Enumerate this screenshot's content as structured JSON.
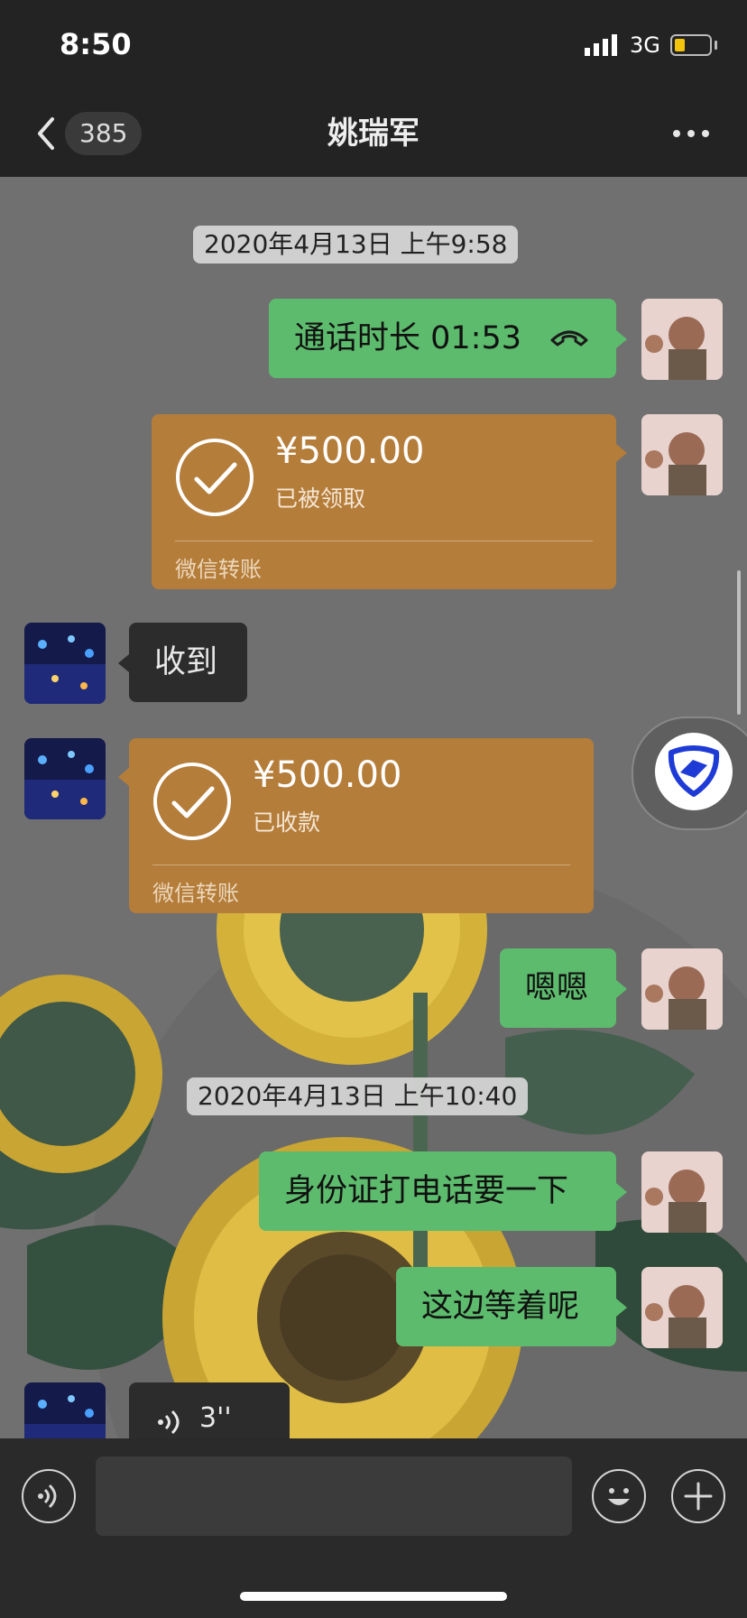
{
  "status_bar": {
    "time": "8:50",
    "network": "3G"
  },
  "header": {
    "unread_count": "385",
    "title": "姚瑞军"
  },
  "messages": {
    "ts1": "2020年4月13日 上午9:58",
    "call": "通话时长 01:53",
    "transfer1": {
      "amount": "¥500.00",
      "status": "已被领取",
      "source": "微信转账"
    },
    "received": "收到",
    "transfer2": {
      "amount": "¥500.00",
      "status": "已收款",
      "source": "微信转账"
    },
    "enen": "嗯嗯",
    "ts2": "2020年4月13日 上午10:40",
    "msg1": "身份证打电话要一下",
    "msg2": "这边等着呢",
    "voice_length": "3''"
  },
  "colors": {
    "sent_bubble": "#5dbb6d",
    "received_bubble": "#2c2c2c",
    "transfer_bubble": "#b57d3a",
    "bar_background": "#232323"
  },
  "icons": {
    "back": "chevron-left-icon",
    "more": "more-dots-icon",
    "phone": "phone-hangup-icon",
    "check": "check-circle-icon",
    "voice": "voice-icon",
    "emoji": "emoji-icon",
    "add": "plus-icon",
    "shield": "shield-icon"
  }
}
